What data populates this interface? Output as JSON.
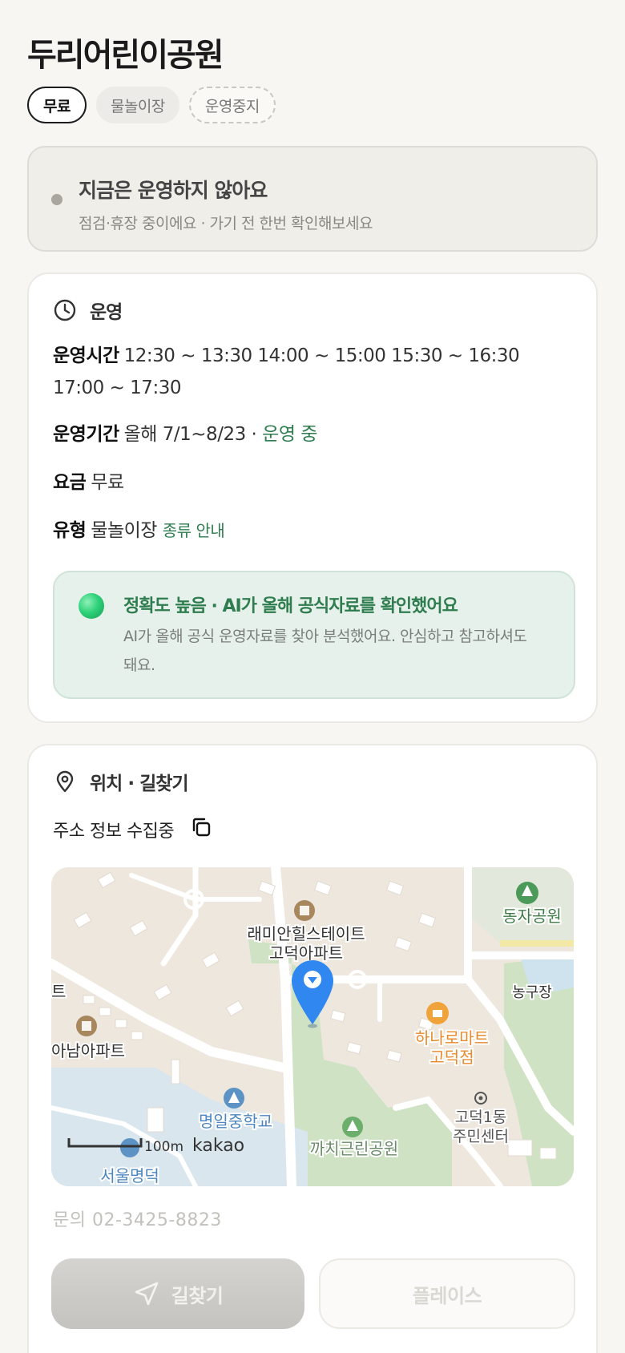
{
  "title": "두리어린이공원",
  "chips": {
    "free": "무료",
    "type": "물놀이장",
    "stopped": "운영중지"
  },
  "status": {
    "title": "지금은 운영하지 않아요",
    "subtitle": "점검·휴장 중이에요 · 가기 전 한번 확인해보세요"
  },
  "operation": {
    "section_label": "운영",
    "hours_label": "운영시간",
    "hours_value": "12:30 ~ 13:30 14:00 ~ 15:00 15:30 ~ 16:30 17:00 ~ 17:30",
    "period_label": "운영기간",
    "period_value": "올해 7/1~8/23 ·",
    "period_status": "운영 중",
    "fee_label": "요금",
    "fee_value": "무료",
    "type_label": "유형",
    "type_value": "물놀이장",
    "type_link": "종류 안내"
  },
  "ai_notice": {
    "title": "정확도 높음 · AI가 올해 공식자료를 확인했어요",
    "body": "AI가 올해 공식 운영자료를 찾아 분석했어요. 안심하고 참고하셔도 돼요."
  },
  "location": {
    "section_label": "위치 · 길찾기",
    "address": "주소 정보 수집중",
    "map": {
      "labels": {
        "apt1_line1": "래미안힐스테이트",
        "apt1_line2": "고덕아파트",
        "park1": "동자공원",
        "court": "농구장",
        "mart_line1": "하나로마트",
        "mart_line2": "고덕점",
        "apt2": "아남아파트",
        "apt2_edge": "트",
        "school": "명일중학교",
        "center_line1": "고덕1동",
        "center_line2": "주민센터",
        "park2": "까치근린공원",
        "school2": "서울명덕",
        "scale": "100m",
        "brand": "kakao"
      },
      "colors": {
        "land": "#eee7de",
        "park": "#cfe2c4",
        "water": "#cfe3ef",
        "pin": "#2f87ef"
      }
    },
    "phone": "문의 02-3425-8823"
  },
  "buttons": {
    "route": "길찾기",
    "place": "플레이스"
  },
  "icons": {
    "status_dot": "status-dot-icon",
    "clock": "clock-icon",
    "pin": "location-pin-icon",
    "copy": "copy-icon",
    "navigate": "navigation-arrow-icon"
  }
}
